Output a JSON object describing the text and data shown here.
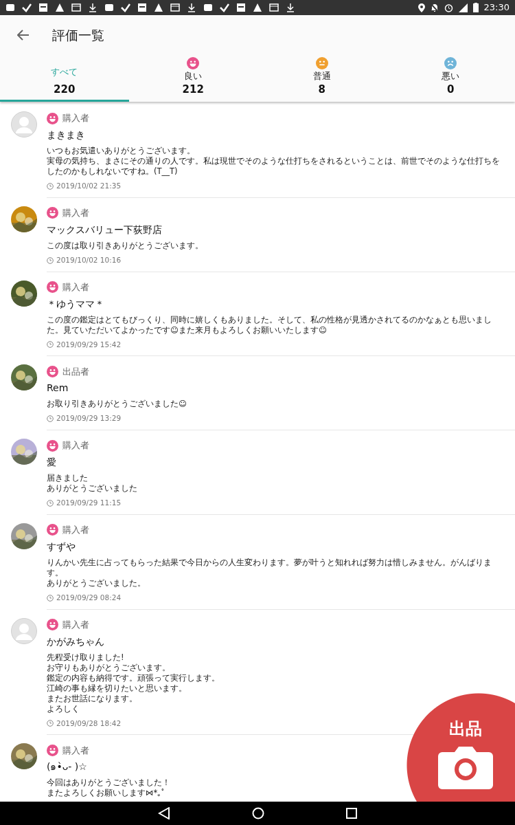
{
  "status_bar": {
    "time": "23:30"
  },
  "app_bar": {
    "title": "評価一覧"
  },
  "tabs": [
    {
      "label": "すべて",
      "count": "220",
      "selected": true
    },
    {
      "label": "良い",
      "count": "212",
      "selected": false,
      "color": "#e8528b"
    },
    {
      "label": "普通",
      "count": "8",
      "selected": false,
      "color": "#f0a030"
    },
    {
      "label": "悪い",
      "count": "0",
      "selected": false,
      "color": "#6fb4d8"
    }
  ],
  "reviews": [
    {
      "kind": "default",
      "color": "#e8528b",
      "role": "購入者",
      "name": "まきまき",
      "comment_lines": [
        "いつもお気遣いありがとうございます。",
        "実母の気持ち、まさにその通りの人です。私は現世でそのような仕打ちをされるということは、前世でそのような仕打ちをしたのかもしれないですね。(T__T)"
      ],
      "date": "2019/10/02 21:35"
    },
    {
      "kind": "picture",
      "color": "#e8528b",
      "role": "購入者",
      "name": "マックスバリュー下荻野店",
      "comment_lines": [
        "この度は取り引きありがとうございます。"
      ],
      "date": "2019/10/02 10:16"
    },
    {
      "kind": "picture",
      "color": "#e8528b",
      "role": "購入者",
      "name": "＊ゆうママ＊",
      "comment_lines": [
        "この度の鑑定はとてもびっくり、同時に嬉しくもありました。そして、私の性格が見透かされてるのかなぁとも思いました。見ていただいてよかったです☺また来月もよろしくお願いいたします☺"
      ],
      "date": "2019/09/29 15:42"
    },
    {
      "kind": "picture",
      "color": "#e8528b",
      "role": "出品者",
      "name": "Rem",
      "comment_lines": [
        "お取り引きありがとうございました☺"
      ],
      "date": "2019/09/29 13:29"
    },
    {
      "kind": "picture",
      "color": "#e8528b",
      "role": "購入者",
      "name": "愛",
      "comment_lines": [
        "届きました",
        "ありがとうございました"
      ],
      "date": "2019/09/29 11:15"
    },
    {
      "kind": "picture",
      "color": "#e8528b",
      "role": "購入者",
      "name": "すずや",
      "comment_lines": [
        "りんかい先生に占ってもらった結果で今日からの人生変わります。夢が叶うと知れれば努力は惜しみません。がんばります。",
        "ありがとうございました。"
      ],
      "date": "2019/09/29 08:24"
    },
    {
      "kind": "default",
      "color": "#e8528b",
      "role": "購入者",
      "name": "かがみちゃん",
      "comment_lines": [
        "先程受け取りました!",
        "お守りもありがとうございます。",
        "鑑定の内容も納得です。頑張って実行します。",
        "江崎の事も縁を切りたいと思います。",
        "またお世話になります。",
        "よろしく"
      ],
      "date": "2019/09/28 18:42"
    },
    {
      "kind": "picture",
      "color": "#e8528b",
      "role": "購入者",
      "name": "(๑•̀ᴗ- )☆",
      "comment_lines": [
        "今回はありがとうございました！",
        "またよろしくお願いします⋈*｡ﾟ"
      ]
    }
  ],
  "fab": {
    "label": "出品"
  }
}
